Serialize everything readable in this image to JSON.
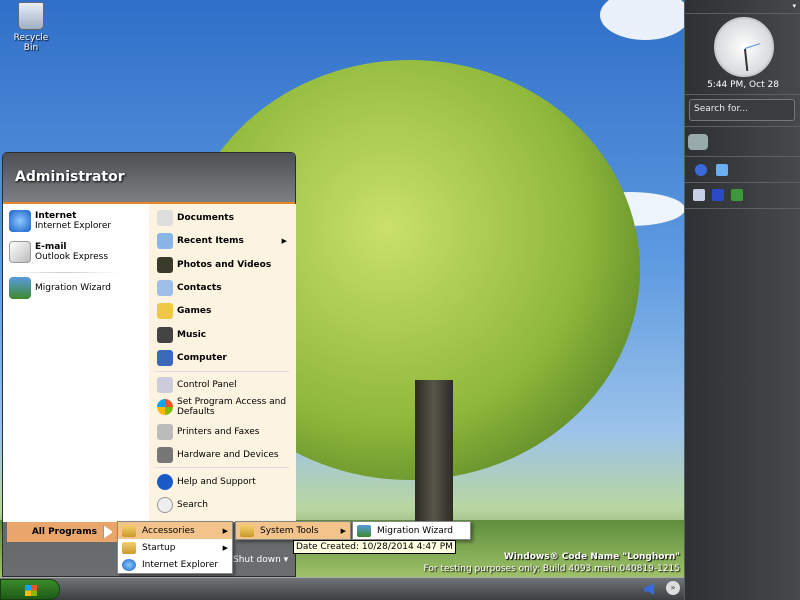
{
  "desktop": {
    "recycle_bin": "Recycle Bin",
    "watermark_title": "Windows® Code Name \"Longhorn\"",
    "watermark_build": "For testing purposes only: Build 4093.main.040819-1215"
  },
  "start_menu": {
    "user": "Administrator",
    "pinned": [
      {
        "title": "Internet",
        "subtitle": "Internet Explorer"
      },
      {
        "title": "E-mail",
        "subtitle": "Outlook Express"
      }
    ],
    "recent": [
      {
        "label": "Migration Wizard"
      }
    ],
    "right": [
      "Documents",
      "Recent Items",
      "Photos and Videos",
      "Contacts",
      "Games",
      "Music",
      "Computer",
      "Control Panel",
      "Set Program Access and Defaults",
      "Printers and Faxes",
      "Hardware and Devices",
      "Help and Support",
      "Search"
    ],
    "all_programs": "All Programs",
    "shut_down": "Shut down"
  },
  "programs_menu": [
    "Accessories",
    "Startup",
    "Internet Explorer"
  ],
  "accessories_menu": [
    "System Tools"
  ],
  "system_tools_menu": [
    "Migration Wizard"
  ],
  "tooltip": "Date Created: 10/28/2014 4:47 PM",
  "sidebar": {
    "clock_text": "5:44 PM, Oct 28",
    "search_placeholder": "Search for..."
  }
}
